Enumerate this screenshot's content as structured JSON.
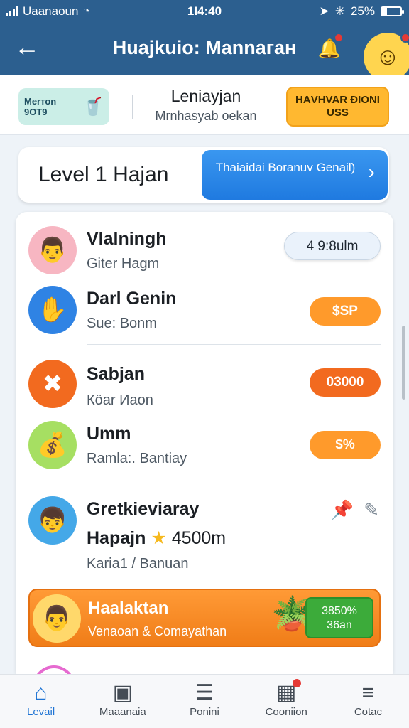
{
  "status": {
    "carrier": "Uaanaoun",
    "time": "1Ι4:40",
    "battery": "25%",
    "battery_level": 0.25
  },
  "header": {
    "title": "Huajkuio: Mannaган"
  },
  "promo": {
    "tag_text": "Мerтоn 9ОТ9",
    "center_title": "Leniaуjan",
    "center_sub": "Мrnhasyab oekan",
    "button_label": "НАVНVAR ĐIONI USS"
  },
  "level_card": {
    "title": "Level 1 Hajan",
    "button_label": "Thaiaidai Boranuv Genail)"
  },
  "rows": [
    {
      "name": "Vlalningh",
      "sub": "Gitеr Hagm",
      "value": "4 9:8ulm",
      "icon": "person-avatar-icon"
    },
    {
      "name": "Darl Genin",
      "sub": "Sue: Bonm",
      "value": "$SP",
      "icon": "hand-avatar-icon"
    },
    {
      "name": "Sabjan",
      "sub": "Кöar Иaon",
      "value": "03000",
      "icon": "cross-avatar-icon"
    },
    {
      "name": "Umm",
      "sub": "Ramla:. Bantiay",
      "value": "$%",
      "icon": "gold-bar-icon"
    },
    {
      "name": "Gretkieviaray",
      "sub_line1": "Hapajn",
      "sub_line1_value": "4500m",
      "sub": "Karia1 / Banuan",
      "icon": "child-avatar-icon"
    }
  ],
  "highlight": {
    "title": "Haalaktan",
    "subtitle": "Venaoan & Comayathan",
    "badge_line1": "3850%",
    "badge_line2": "36an"
  },
  "nav": [
    {
      "label": "Levail",
      "icon": "home-icon"
    },
    {
      "label": "Maaanaia",
      "icon": "map-icon"
    },
    {
      "label": "Ponini",
      "icon": "document-icon"
    },
    {
      "label": "Cooniion",
      "icon": "calendar-icon"
    },
    {
      "label": "Cotac",
      "icon": "menu-icon"
    }
  ]
}
